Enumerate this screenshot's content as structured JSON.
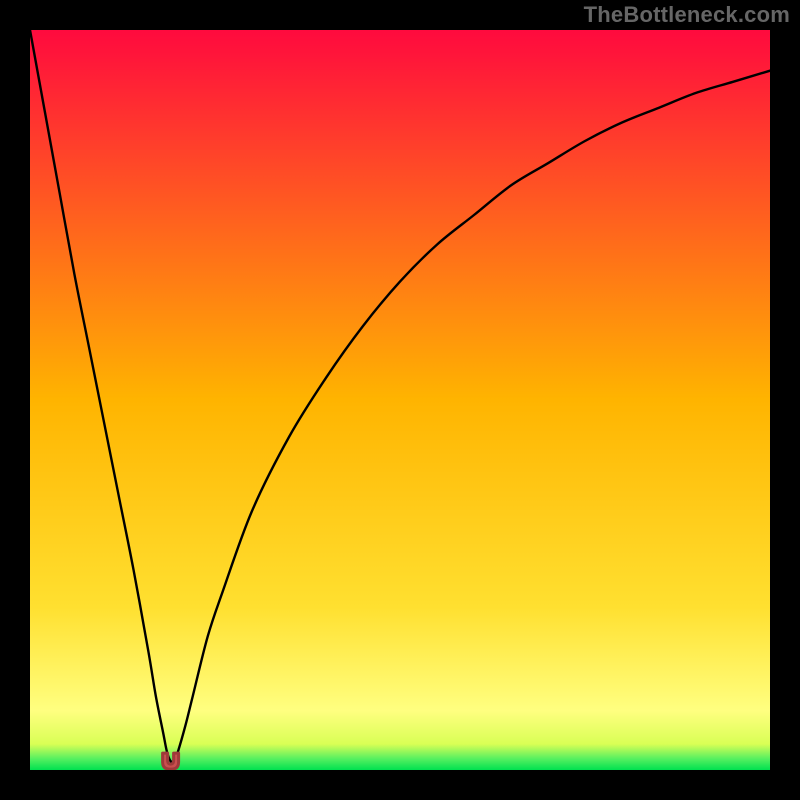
{
  "watermark": "TheBottleneck.com",
  "colors": {
    "bg_black": "#000000",
    "grad_top": "#ff0a3e",
    "grad_mid": "#ffd700",
    "grad_yellow": "#ffff66",
    "grad_bottom_green": "#00e150",
    "curve": "#000000",
    "marker_fill": "#c94f4f",
    "marker_stroke": "#9e3a3a"
  },
  "chart_data": {
    "type": "line",
    "title": "",
    "xlabel": "",
    "ylabel": "",
    "xlim": [
      0,
      100
    ],
    "ylim": [
      0,
      100
    ],
    "series": [
      {
        "name": "bottleneck-curve",
        "x": [
          0,
          2,
          4,
          6,
          8,
          10,
          12,
          14,
          16,
          17,
          18,
          18.5,
          19,
          19.5,
          20,
          21,
          22,
          24,
          26,
          30,
          35,
          40,
          45,
          50,
          55,
          60,
          65,
          70,
          75,
          80,
          85,
          90,
          95,
          100
        ],
        "values": [
          100,
          89,
          78,
          67,
          57,
          47,
          37,
          27,
          16,
          10,
          5,
          2.5,
          1.2,
          1.2,
          2.5,
          6,
          10,
          18,
          24,
          35,
          45,
          53,
          60,
          66,
          71,
          75,
          79,
          82,
          85,
          87.5,
          89.5,
          91.5,
          93,
          94.5
        ]
      }
    ],
    "marker": {
      "name": "optimal-point",
      "x": 19,
      "value": 1.2,
      "shape": "u"
    },
    "gradient_bands": [
      {
        "pos": 0.0,
        "color": "#ff0a3e"
      },
      {
        "pos": 0.5,
        "color": "#ffb400"
      },
      {
        "pos": 0.78,
        "color": "#ffe030"
      },
      {
        "pos": 0.92,
        "color": "#ffff80"
      },
      {
        "pos": 0.965,
        "color": "#d9ff55"
      },
      {
        "pos": 0.985,
        "color": "#55f060"
      },
      {
        "pos": 1.0,
        "color": "#00e150"
      }
    ]
  }
}
